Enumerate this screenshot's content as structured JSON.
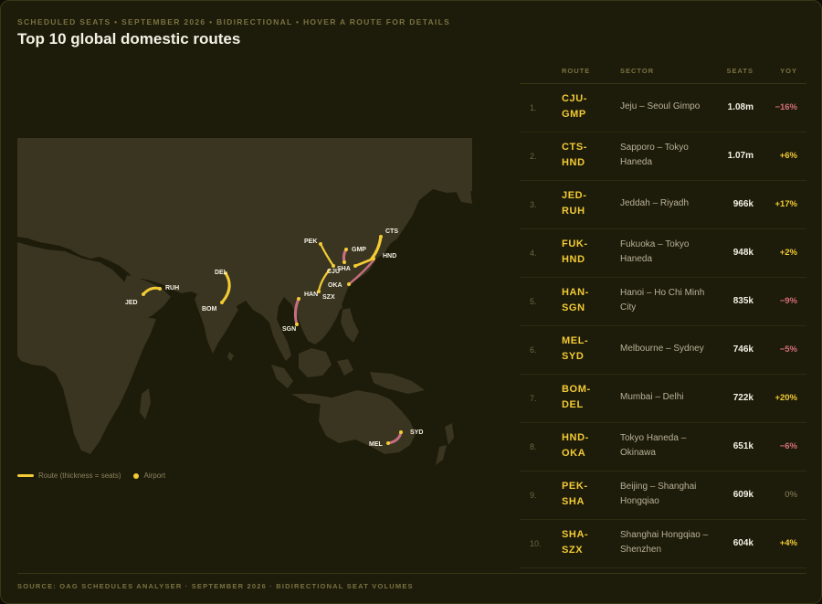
{
  "header": {
    "subtitle": "SCHEDULED SEATS • SEPTEMBER 2026 • BIDIRECTIONAL • HOVER A ROUTE FOR DETAILS",
    "title": "Top 10 global domestic routes"
  },
  "table": {
    "headers": {
      "route": "ROUTE",
      "sector": "SECTOR",
      "seats": "SEATS",
      "yoy": "YOY"
    },
    "rows": [
      {
        "idx": "1.",
        "code": "CJU-GMP",
        "sector": "Jeju – Seoul Gimpo",
        "seats": "1.08m",
        "yoy": "−16%",
        "trend": "neg"
      },
      {
        "idx": "2.",
        "code": "CTS-HND",
        "sector": "Sapporo – Tokyo Haneda",
        "seats": "1.07m",
        "yoy": "+6%",
        "trend": "pos"
      },
      {
        "idx": "3.",
        "code": "JED-RUH",
        "sector": "Jeddah – Riyadh",
        "seats": "966k",
        "yoy": "+17%",
        "trend": "pos"
      },
      {
        "idx": "4.",
        "code": "FUK-HND",
        "sector": "Fukuoka – Tokyo Haneda",
        "seats": "948k",
        "yoy": "+2%",
        "trend": "pos"
      },
      {
        "idx": "5.",
        "code": "HAN-SGN",
        "sector": "Hanoi – Ho Chi Minh City",
        "seats": "835k",
        "yoy": "−9%",
        "trend": "neg"
      },
      {
        "idx": "6.",
        "code": "MEL-SYD",
        "sector": "Melbourne – Sydney",
        "seats": "746k",
        "yoy": "−5%",
        "trend": "neg"
      },
      {
        "idx": "7.",
        "code": "BOM-DEL",
        "sector": "Mumbai – Delhi",
        "seats": "722k",
        "yoy": "+20%",
        "trend": "pos"
      },
      {
        "idx": "8.",
        "code": "HND-OKA",
        "sector": "Tokyo Haneda – Okinawa",
        "seats": "651k",
        "yoy": "−6%",
        "trend": "neg"
      },
      {
        "idx": "9.",
        "code": "PEK-SHA",
        "sector": "Beijing – Shanghai Hongqiao",
        "seats": "609k",
        "yoy": "0%",
        "trend": "zero"
      },
      {
        "idx": "10.",
        "code": "SHA-SZX",
        "sector": "Shanghai Hongqiao – Shenzhen",
        "seats": "604k",
        "yoy": "+4%",
        "trend": "pos"
      }
    ]
  },
  "map": {
    "airports": [
      "JED",
      "RUH",
      "DEL",
      "BOM",
      "PEK",
      "GMP",
      "CJU",
      "SHA",
      "CTS",
      "HND",
      "OKA",
      "HAN",
      "SZX",
      "SGN",
      "MEL",
      "SYD"
    ],
    "colors": {
      "route_up": "#f2cb35",
      "route_down": "#c76e80",
      "land": "#3a3521",
      "airport": "#f2cb35"
    }
  },
  "legend": {
    "route": "Route (thickness = seats)",
    "airport": "Airport"
  },
  "footer": {
    "source": "SOURCE: OAG SCHEDULES ANALYSER · SEPTEMBER 2026 · BIDIRECTIONAL SEAT VOLUMES"
  }
}
